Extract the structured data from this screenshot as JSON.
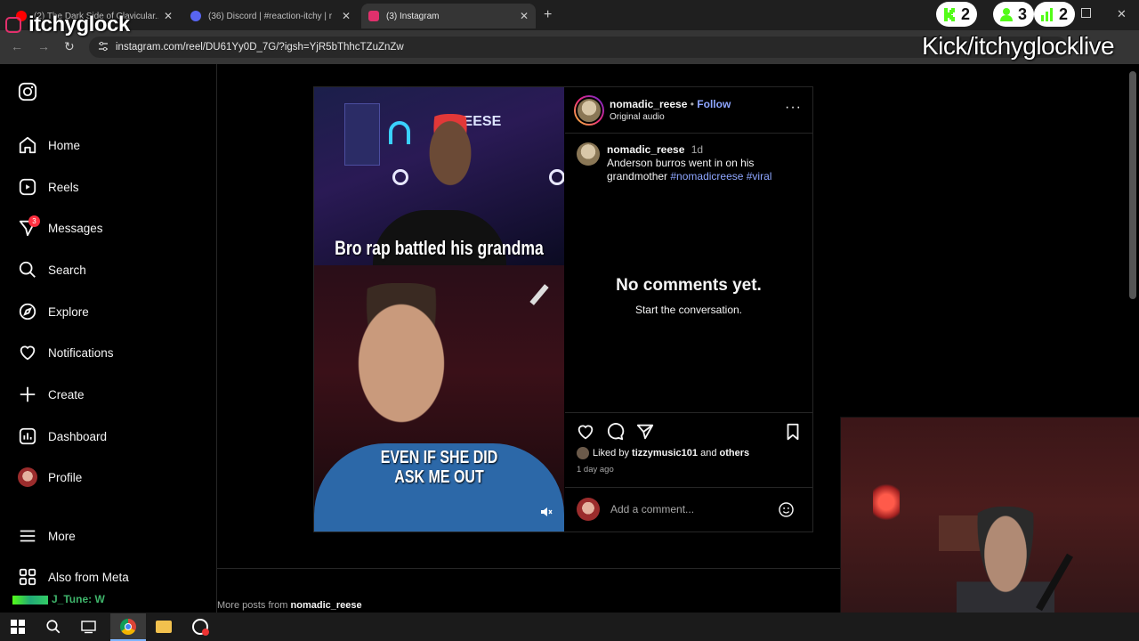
{
  "browser": {
    "tabs": [
      {
        "title": "(2) The Dark Side of Clavicular...",
        "favicon_color": "#ff0000",
        "active": false
      },
      {
        "title": "(36) Discord | #reaction-itchy | r",
        "favicon_color": "#5865f2",
        "active": false
      },
      {
        "title": "(3) Instagram",
        "favicon_color": "#e1306c",
        "active": true
      }
    ],
    "new_tab": "+",
    "url": "instagram.com/reel/DU61Yy0D_7G/?igsh=YjR5bThhcTZuZnZw",
    "window_controls": {
      "close": "✕"
    }
  },
  "stream_overlay": {
    "streamer_name": "itchyglock",
    "kick_handle": "Kick/itchyglocklive",
    "stats": [
      {
        "icon": "kick-icon",
        "value": "2",
        "color": "#53fc18"
      },
      {
        "icon": "viewer-icon",
        "value": "3",
        "color": "#53fc18"
      },
      {
        "icon": "chart-icon",
        "value": "2",
        "color": "#53fc18"
      }
    ],
    "chat_line": "J_Tune: W"
  },
  "sidebar": {
    "items": [
      {
        "label": "Home",
        "icon": "home-icon"
      },
      {
        "label": "Reels",
        "icon": "reels-icon"
      },
      {
        "label": "Messages",
        "icon": "messages-icon",
        "badge": "3"
      },
      {
        "label": "Search",
        "icon": "search-icon"
      },
      {
        "label": "Explore",
        "icon": "explore-icon"
      },
      {
        "label": "Notifications",
        "icon": "heart-icon"
      },
      {
        "label": "Create",
        "icon": "plus-icon"
      },
      {
        "label": "Dashboard",
        "icon": "dashboard-icon"
      },
      {
        "label": "Profile",
        "icon": "avatar"
      }
    ],
    "more_label": "More",
    "also_label": "Also from Meta"
  },
  "post": {
    "author": "nomadic_reese",
    "follow_sep": "•",
    "follow_label": "Follow",
    "audio": "Original audio",
    "caption_author": "nomadic_reese",
    "caption_age": "1d",
    "caption_text": "Anderson burros went in on his grandmother ",
    "hashtags": "#nomadicreese #viral",
    "no_comments": "No comments yet.",
    "start_conversation": "Start the conversation.",
    "liked_by_prefix": "Liked by ",
    "liked_by_user": "tizzymusic101",
    "liked_by_and": " and ",
    "liked_by_others": "others",
    "posted_ago": "1 day ago",
    "comment_placeholder": "Add a comment...",
    "video_caption_top": "Bro rap battled his grandma",
    "video_caption_bottom": "EVEN IF SHE DID ASK ME OUT",
    "video_sign": "ICREESE"
  },
  "more_posts": {
    "prefix": "More posts from ",
    "user": "nomadic_reese"
  }
}
